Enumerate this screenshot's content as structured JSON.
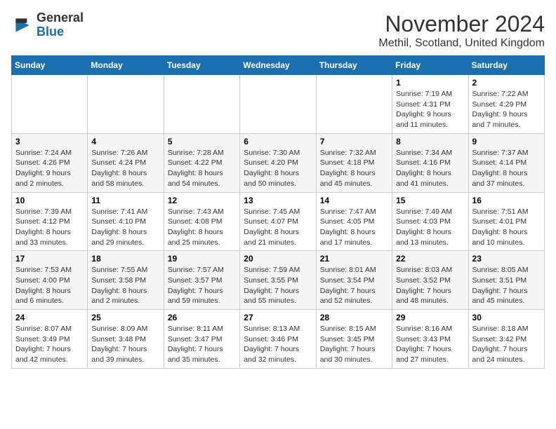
{
  "header": {
    "logo_general": "General",
    "logo_blue": "Blue",
    "month_title": "November 2024",
    "location": "Methil, Scotland, United Kingdom"
  },
  "weekdays": [
    "Sunday",
    "Monday",
    "Tuesday",
    "Wednesday",
    "Thursday",
    "Friday",
    "Saturday"
  ],
  "weeks": [
    [
      {
        "day": "",
        "info": ""
      },
      {
        "day": "",
        "info": ""
      },
      {
        "day": "",
        "info": ""
      },
      {
        "day": "",
        "info": ""
      },
      {
        "day": "",
        "info": ""
      },
      {
        "day": "1",
        "info": "Sunrise: 7:19 AM\nSunset: 4:31 PM\nDaylight: 9 hours and 11 minutes."
      },
      {
        "day": "2",
        "info": "Sunrise: 7:22 AM\nSunset: 4:29 PM\nDaylight: 9 hours and 7 minutes."
      }
    ],
    [
      {
        "day": "3",
        "info": "Sunrise: 7:24 AM\nSunset: 4:26 PM\nDaylight: 9 hours and 2 minutes."
      },
      {
        "day": "4",
        "info": "Sunrise: 7:26 AM\nSunset: 4:24 PM\nDaylight: 8 hours and 58 minutes."
      },
      {
        "day": "5",
        "info": "Sunrise: 7:28 AM\nSunset: 4:22 PM\nDaylight: 8 hours and 54 minutes."
      },
      {
        "day": "6",
        "info": "Sunrise: 7:30 AM\nSunset: 4:20 PM\nDaylight: 8 hours and 50 minutes."
      },
      {
        "day": "7",
        "info": "Sunrise: 7:32 AM\nSunset: 4:18 PM\nDaylight: 8 hours and 45 minutes."
      },
      {
        "day": "8",
        "info": "Sunrise: 7:34 AM\nSunset: 4:16 PM\nDaylight: 8 hours and 41 minutes."
      },
      {
        "day": "9",
        "info": "Sunrise: 7:37 AM\nSunset: 4:14 PM\nDaylight: 8 hours and 37 minutes."
      }
    ],
    [
      {
        "day": "10",
        "info": "Sunrise: 7:39 AM\nSunset: 4:12 PM\nDaylight: 8 hours and 33 minutes."
      },
      {
        "day": "11",
        "info": "Sunrise: 7:41 AM\nSunset: 4:10 PM\nDaylight: 8 hours and 29 minutes."
      },
      {
        "day": "12",
        "info": "Sunrise: 7:43 AM\nSunset: 4:08 PM\nDaylight: 8 hours and 25 minutes."
      },
      {
        "day": "13",
        "info": "Sunrise: 7:45 AM\nSunset: 4:07 PM\nDaylight: 8 hours and 21 minutes."
      },
      {
        "day": "14",
        "info": "Sunrise: 7:47 AM\nSunset: 4:05 PM\nDaylight: 8 hours and 17 minutes."
      },
      {
        "day": "15",
        "info": "Sunrise: 7:49 AM\nSunset: 4:03 PM\nDaylight: 8 hours and 13 minutes."
      },
      {
        "day": "16",
        "info": "Sunrise: 7:51 AM\nSunset: 4:01 PM\nDaylight: 8 hours and 10 minutes."
      }
    ],
    [
      {
        "day": "17",
        "info": "Sunrise: 7:53 AM\nSunset: 4:00 PM\nDaylight: 8 hours and 6 minutes."
      },
      {
        "day": "18",
        "info": "Sunrise: 7:55 AM\nSunset: 3:58 PM\nDaylight: 8 hours and 2 minutes."
      },
      {
        "day": "19",
        "info": "Sunrise: 7:57 AM\nSunset: 3:57 PM\nDaylight: 7 hours and 59 minutes."
      },
      {
        "day": "20",
        "info": "Sunrise: 7:59 AM\nSunset: 3:55 PM\nDaylight: 7 hours and 55 minutes."
      },
      {
        "day": "21",
        "info": "Sunrise: 8:01 AM\nSunset: 3:54 PM\nDaylight: 7 hours and 52 minutes."
      },
      {
        "day": "22",
        "info": "Sunrise: 8:03 AM\nSunset: 3:52 PM\nDaylight: 7 hours and 48 minutes."
      },
      {
        "day": "23",
        "info": "Sunrise: 8:05 AM\nSunset: 3:51 PM\nDaylight: 7 hours and 45 minutes."
      }
    ],
    [
      {
        "day": "24",
        "info": "Sunrise: 8:07 AM\nSunset: 3:49 PM\nDaylight: 7 hours and 42 minutes."
      },
      {
        "day": "25",
        "info": "Sunrise: 8:09 AM\nSunset: 3:48 PM\nDaylight: 7 hours and 39 minutes."
      },
      {
        "day": "26",
        "info": "Sunrise: 8:11 AM\nSunset: 3:47 PM\nDaylight: 7 hours and 35 minutes."
      },
      {
        "day": "27",
        "info": "Sunrise: 8:13 AM\nSunset: 3:46 PM\nDaylight: 7 hours and 32 minutes."
      },
      {
        "day": "28",
        "info": "Sunrise: 8:15 AM\nSunset: 3:45 PM\nDaylight: 7 hours and 30 minutes."
      },
      {
        "day": "29",
        "info": "Sunrise: 8:16 AM\nSunset: 3:43 PM\nDaylight: 7 hours and 27 minutes."
      },
      {
        "day": "30",
        "info": "Sunrise: 8:18 AM\nSunset: 3:42 PM\nDaylight: 7 hours and 24 minutes."
      }
    ]
  ]
}
